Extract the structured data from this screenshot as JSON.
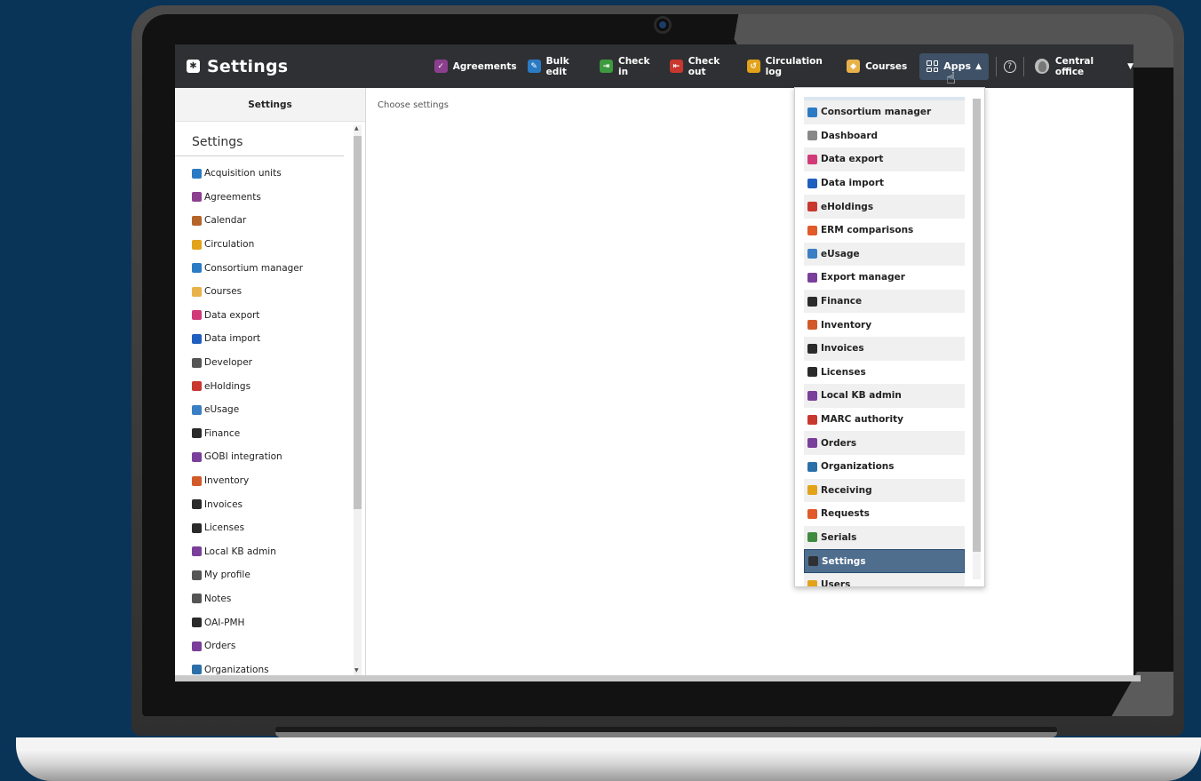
{
  "header": {
    "app_title": "Settings",
    "nav_apps": [
      {
        "label": "Agreements",
        "color": "#8b3f8e",
        "glyph": "✓"
      },
      {
        "label": "Bulk edit",
        "color": "#2b7bc4",
        "glyph": "✎"
      },
      {
        "label": "Check in",
        "color": "#3e9a3e",
        "glyph": "⇥"
      },
      {
        "label": "Check out",
        "color": "#c8382f",
        "glyph": "⇤"
      },
      {
        "label": "Circulation log",
        "color": "#e2a21a",
        "glyph": "↺"
      },
      {
        "label": "Courses",
        "color": "#e8b24a",
        "glyph": "◆"
      }
    ],
    "apps_label": "Apps",
    "help_glyph": "?",
    "user_label": "Central office"
  },
  "left_pane": {
    "header": "Settings",
    "section_title": "Settings",
    "items": [
      {
        "label": "Acquisition units",
        "color": "#2b7bc4"
      },
      {
        "label": "Agreements",
        "color": "#8b3f8e"
      },
      {
        "label": "Calendar",
        "color": "#b5652a"
      },
      {
        "label": "Circulation",
        "color": "#e2a21a"
      },
      {
        "label": "Consortium manager",
        "color": "#2b7bc4"
      },
      {
        "label": "Courses",
        "color": "#e8b24a"
      },
      {
        "label": "Data export",
        "color": "#d13a78"
      },
      {
        "label": "Data import",
        "color": "#1f5fbf"
      },
      {
        "label": "Developer",
        "color": "#555555"
      },
      {
        "label": "eHoldings",
        "color": "#c8382f"
      },
      {
        "label": "eUsage",
        "color": "#3a7fc4"
      },
      {
        "label": "Finance",
        "color": "#2a2a2a"
      },
      {
        "label": "GOBI integration",
        "color": "#7a3f9a"
      },
      {
        "label": "Inventory",
        "color": "#d2592a"
      },
      {
        "label": "Invoices",
        "color": "#2a2a2a"
      },
      {
        "label": "Licenses",
        "color": "#2a2a2a"
      },
      {
        "label": "Local KB admin",
        "color": "#7a3f9a"
      },
      {
        "label": "My profile",
        "color": "#555555"
      },
      {
        "label": "Notes",
        "color": "#555555"
      },
      {
        "label": "OAI-PMH",
        "color": "#2a2a2a"
      },
      {
        "label": "Orders",
        "color": "#7a3f9a"
      },
      {
        "label": "Organizations",
        "color": "#2b6fa8"
      }
    ]
  },
  "main": {
    "placeholder_text": "Choose settings"
  },
  "apps_dropdown": {
    "items": [
      {
        "label": "Consortium manager",
        "color": "#2b7bc4",
        "selected": false
      },
      {
        "label": "Dashboard",
        "color": "#888888",
        "selected": false
      },
      {
        "label": "Data export",
        "color": "#d13a78",
        "selected": false
      },
      {
        "label": "Data import",
        "color": "#1f5fbf",
        "selected": false
      },
      {
        "label": "eHoldings",
        "color": "#c8382f",
        "selected": false
      },
      {
        "label": "ERM comparisons",
        "color": "#e05a2a",
        "selected": false
      },
      {
        "label": "eUsage",
        "color": "#3a7fc4",
        "selected": false
      },
      {
        "label": "Export manager",
        "color": "#7a3f9a",
        "selected": false
      },
      {
        "label": "Finance",
        "color": "#2a2a2a",
        "selected": false
      },
      {
        "label": "Inventory",
        "color": "#d2592a",
        "selected": false
      },
      {
        "label": "Invoices",
        "color": "#2a2a2a",
        "selected": false
      },
      {
        "label": "Licenses",
        "color": "#2a2a2a",
        "selected": false
      },
      {
        "label": "Local KB admin",
        "color": "#7a3f9a",
        "selected": false
      },
      {
        "label": "MARC authority",
        "color": "#c8382f",
        "selected": false
      },
      {
        "label": "Orders",
        "color": "#7a3f9a",
        "selected": false
      },
      {
        "label": "Organizations",
        "color": "#2b6fa8",
        "selected": false
      },
      {
        "label": "Receiving",
        "color": "#e2a21a",
        "selected": false
      },
      {
        "label": "Requests",
        "color": "#e05a2a",
        "selected": false
      },
      {
        "label": "Serials",
        "color": "#3e8a3e",
        "selected": false
      },
      {
        "label": "Settings",
        "color": "#2f3033",
        "selected": true
      },
      {
        "label": "Users",
        "color": "#e2a21a",
        "selected": false
      }
    ]
  }
}
